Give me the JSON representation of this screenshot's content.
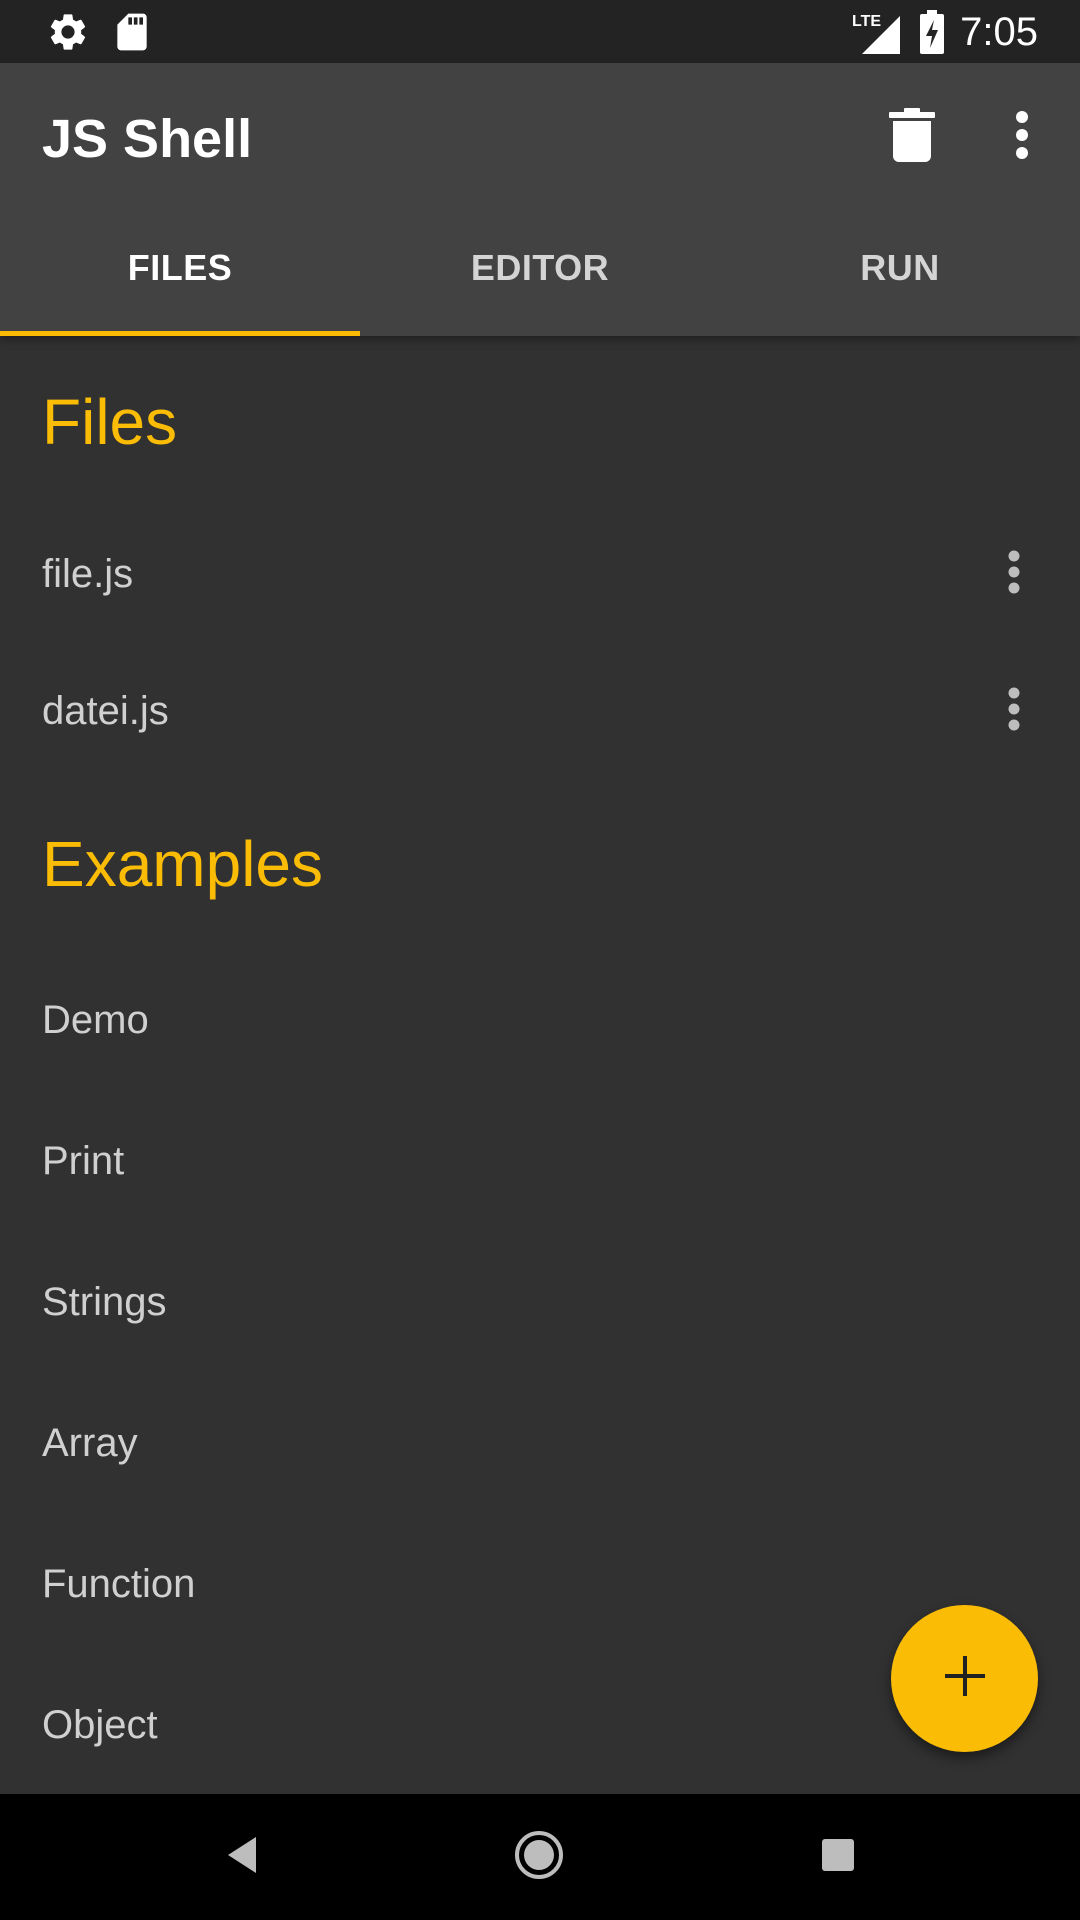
{
  "status_bar": {
    "time": "7:05",
    "left_icons": [
      "settings-icon",
      "sd-card-icon"
    ],
    "right_icons": [
      "lte-signal-icon",
      "battery-charging-icon"
    ],
    "network_label": "LTE"
  },
  "app_bar": {
    "title": "JS Shell",
    "actions": [
      "delete-icon",
      "more-vert-icon"
    ]
  },
  "tabs": [
    {
      "label": "FILES",
      "active": true
    },
    {
      "label": "EDITOR",
      "active": false
    },
    {
      "label": "RUN",
      "active": false
    }
  ],
  "sections": {
    "files": {
      "title": "Files",
      "items": [
        {
          "label": "file.js"
        },
        {
          "label": "datei.js"
        }
      ]
    },
    "examples": {
      "title": "Examples",
      "items": [
        {
          "label": "Demo"
        },
        {
          "label": "Print"
        },
        {
          "label": "Strings"
        },
        {
          "label": "Array"
        },
        {
          "label": "Function"
        },
        {
          "label": "Object"
        }
      ]
    }
  },
  "fab": {
    "icon": "add-icon"
  },
  "colors": {
    "accent": "#fbbc05",
    "background": "#313131",
    "app_bar": "#424242",
    "status_bar": "#232323"
  }
}
